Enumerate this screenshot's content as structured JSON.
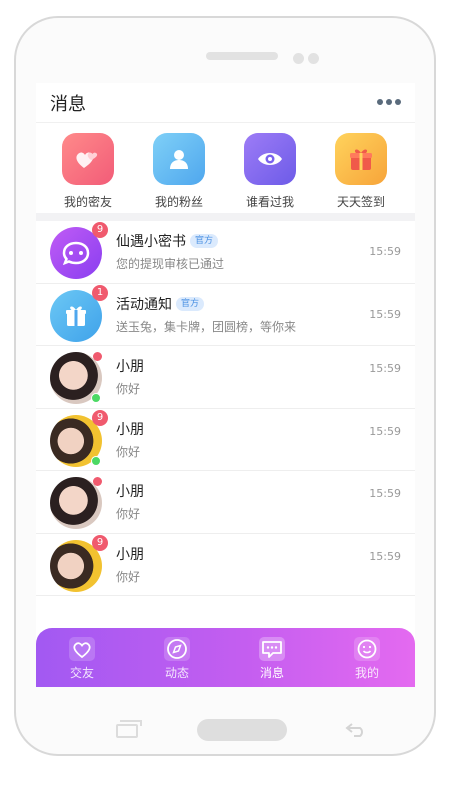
{
  "header": {
    "title": "消息"
  },
  "quick_actions": [
    {
      "label": "我的密友",
      "icon": "hearts-icon",
      "color": "#f7727f"
    },
    {
      "label": "我的粉丝",
      "icon": "user-icon",
      "color": "#5db8f0"
    },
    {
      "label": "谁看过我",
      "icon": "eye-icon",
      "color": "#8a6cf0"
    },
    {
      "label": "天天签到",
      "icon": "gift-icon",
      "color": "#f9b53a"
    }
  ],
  "conversations": [
    {
      "name": "仙遇小密书",
      "tag": "官方",
      "preview": "您的提现审核已通过",
      "time": "15:59",
      "badge": "9"
    },
    {
      "name": "活动通知",
      "tag": "官方",
      "preview": "送玉兔，集卡牌，团圆榜，等你来",
      "time": "15:59",
      "badge": "1"
    },
    {
      "name": "小朋",
      "preview": "你好",
      "time": "15:59"
    },
    {
      "name": "小朋",
      "preview": "你好",
      "time": "15:59",
      "badge": "9"
    },
    {
      "name": "小朋",
      "preview": "你好",
      "time": "15:59"
    },
    {
      "name": "小朋",
      "preview": "你好",
      "time": "15:59",
      "badge": "9"
    }
  ],
  "tabbar": {
    "tabs": [
      {
        "label": "交友",
        "icon": "heart-icon"
      },
      {
        "label": "动态",
        "icon": "compass-icon"
      },
      {
        "label": "消息",
        "icon": "chat-icon",
        "active": true
      },
      {
        "label": "我的",
        "icon": "smile-icon"
      }
    ],
    "gradient": [
      "#a259f2",
      "#e46af0"
    ]
  }
}
